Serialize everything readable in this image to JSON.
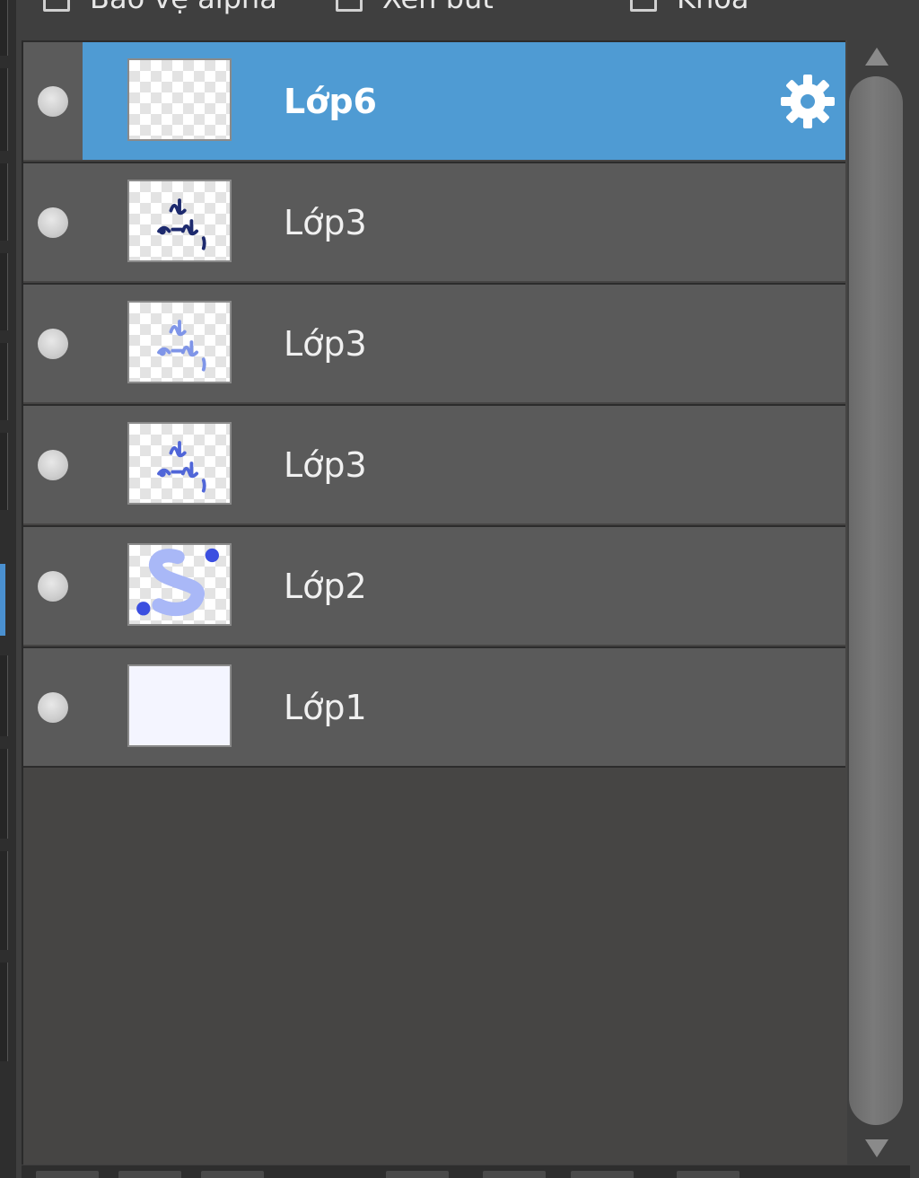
{
  "options": [
    {
      "label": "Bảo vệ alpha",
      "checked": false
    },
    {
      "label": "Xén bút",
      "checked": false
    },
    {
      "label": "Khóa",
      "checked": false
    }
  ],
  "layers": [
    {
      "name": "Lớp6",
      "selected": true,
      "visible": true,
      "thumbnail": "empty-transparent"
    },
    {
      "name": "Lớp3",
      "selected": false,
      "visible": true,
      "thumbnail": "dark-blue-handwriting"
    },
    {
      "name": "Lớp3",
      "selected": false,
      "visible": true,
      "thumbnail": "light-blue-handwriting"
    },
    {
      "name": "Lớp3",
      "selected": false,
      "visible": true,
      "thumbnail": "blue-handwriting"
    },
    {
      "name": "Lớp2",
      "selected": false,
      "visible": true,
      "thumbnail": "blue-squiggle"
    },
    {
      "name": "Lớp1",
      "selected": false,
      "visible": true,
      "thumbnail": "white-fill"
    }
  ],
  "icons": {
    "layer_settings": "gear-icon",
    "visibility": "visibility-dot-icon",
    "scroll_up": "triangle-up-icon",
    "scroll_down": "triangle-down-icon"
  },
  "colors": {
    "selection": "#4f9bd3",
    "row": "#5a5a5a",
    "panel": "#464544"
  }
}
